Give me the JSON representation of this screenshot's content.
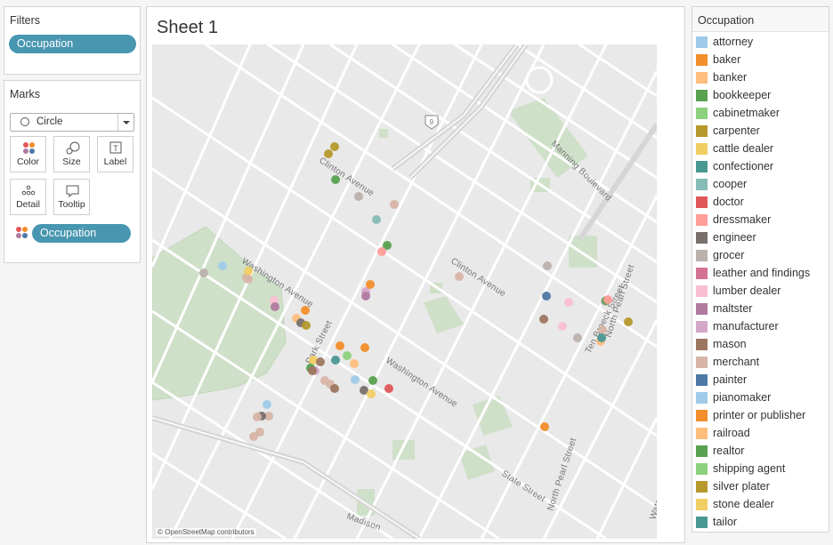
{
  "filters": {
    "title": "Filters",
    "pill": "Occupation"
  },
  "marks": {
    "title": "Marks",
    "mark_type": "Circle",
    "buttons": {
      "color": "Color",
      "size": "Size",
      "label": "Label",
      "detail": "Detail",
      "tooltip": "Tooltip"
    },
    "pill": "Occupation"
  },
  "sheet": {
    "title": "Sheet 1",
    "credit": "© OpenStreetMap contributors",
    "street_labels": {
      "clinton1": "Clinton Avenue",
      "clinton2": "Clinton Avenue",
      "washington1": "Washington Avenue",
      "washington2": "Washington Avenue",
      "park": "Park Street",
      "manning": "Manning Boulevard",
      "tenbroeck": "Ten Broeck Street",
      "northpearl1": "North Pearl Street",
      "northpearl2": "North Pearl Street",
      "state": "State Street",
      "water": "Water Street",
      "madison": "Madison",
      "route": "9"
    }
  },
  "legend": {
    "title": "Occupation",
    "items": [
      {
        "label": "attorney",
        "color": "#9ecae9"
      },
      {
        "label": "baker",
        "color": "#f28e2b"
      },
      {
        "label": "banker",
        "color": "#ffbe7d"
      },
      {
        "label": "bookkeeper",
        "color": "#59a14f"
      },
      {
        "label": "cabinetmaker",
        "color": "#8cd17d"
      },
      {
        "label": "carpenter",
        "color": "#b6992d"
      },
      {
        "label": "cattle dealer",
        "color": "#f1ce63"
      },
      {
        "label": "confectioner",
        "color": "#499894"
      },
      {
        "label": "cooper",
        "color": "#86bcb6"
      },
      {
        "label": "doctor",
        "color": "#e15759"
      },
      {
        "label": "dressmaker",
        "color": "#ff9d9a"
      },
      {
        "label": "engineer",
        "color": "#79706e"
      },
      {
        "label": "grocer",
        "color": "#bab0ac"
      },
      {
        "label": "leather and findings",
        "color": "#d37295"
      },
      {
        "label": "lumber dealer",
        "color": "#fabfd2"
      },
      {
        "label": "maltster",
        "color": "#b07aa1"
      },
      {
        "label": "manufacturer",
        "color": "#d4a6c8"
      },
      {
        "label": "mason",
        "color": "#9d7660"
      },
      {
        "label": "merchant",
        "color": "#d7b5a6"
      },
      {
        "label": "painter",
        "color": "#4e79a7"
      },
      {
        "label": "pianomaker",
        "color": "#a0cbe8"
      },
      {
        "label": "printer or publisher",
        "color": "#f28e2b"
      },
      {
        "label": "railroad",
        "color": "#ffbe7d"
      },
      {
        "label": "realtor",
        "color": "#59a14f"
      },
      {
        "label": "shipping agent",
        "color": "#8cd17d"
      },
      {
        "label": "silver plater",
        "color": "#b6992d"
      },
      {
        "label": "stone dealer",
        "color": "#f1ce63"
      },
      {
        "label": "tailor",
        "color": "#499894"
      }
    ]
  },
  "points": [
    {
      "o": "carpenter"
    },
    {
      "o": "carpenter"
    },
    {
      "o": "bookkeeper"
    },
    {
      "o": "grocer"
    },
    {
      "o": "merchant"
    },
    {
      "o": "cooper"
    },
    {
      "o": "realtor"
    },
    {
      "o": "dressmaker"
    },
    {
      "o": "grocer"
    },
    {
      "o": "merchant"
    },
    {
      "o": "pianomaker"
    },
    {
      "o": "stone dealer"
    },
    {
      "o": "merchant"
    },
    {
      "o": "merchant"
    },
    {
      "o": "lumber dealer"
    },
    {
      "o": "maltster"
    },
    {
      "o": "manufacturer"
    },
    {
      "o": "baker"
    },
    {
      "o": "maltster"
    },
    {
      "o": "printer or publisher"
    },
    {
      "o": "railroad"
    },
    {
      "o": "engineer"
    },
    {
      "o": "silver plater"
    },
    {
      "o": "baker"
    },
    {
      "o": "printer or publisher"
    },
    {
      "o": "shipping agent"
    },
    {
      "o": "cattle dealer"
    },
    {
      "o": "bookkeeper"
    },
    {
      "o": "confectioner"
    },
    {
      "o": "banker"
    },
    {
      "o": "manufacturer"
    },
    {
      "o": "mason"
    },
    {
      "o": "merchant"
    },
    {
      "o": "merchant"
    },
    {
      "o": "mason"
    },
    {
      "o": "pianomaker"
    },
    {
      "o": "mason"
    },
    {
      "o": "engineer"
    },
    {
      "o": "realtor"
    },
    {
      "o": "cattle dealer"
    },
    {
      "o": "doctor"
    },
    {
      "o": "attorney"
    },
    {
      "o": "merchant"
    },
    {
      "o": "engineer"
    },
    {
      "o": "merchant"
    },
    {
      "o": "merchant"
    },
    {
      "o": "merchant"
    },
    {
      "o": "grocer"
    },
    {
      "o": "painter"
    },
    {
      "o": "mason"
    },
    {
      "o": "lumber dealer"
    },
    {
      "o": "grocer"
    },
    {
      "o": "lumber dealer"
    },
    {
      "o": "merchant"
    },
    {
      "o": "banker"
    },
    {
      "o": "confectioner"
    },
    {
      "o": "grocer"
    },
    {
      "o": "silver plater"
    },
    {
      "o": "printer or publisher"
    },
    {
      "o": "bookkeeper"
    },
    {
      "o": "dressmaker"
    }
  ]
}
